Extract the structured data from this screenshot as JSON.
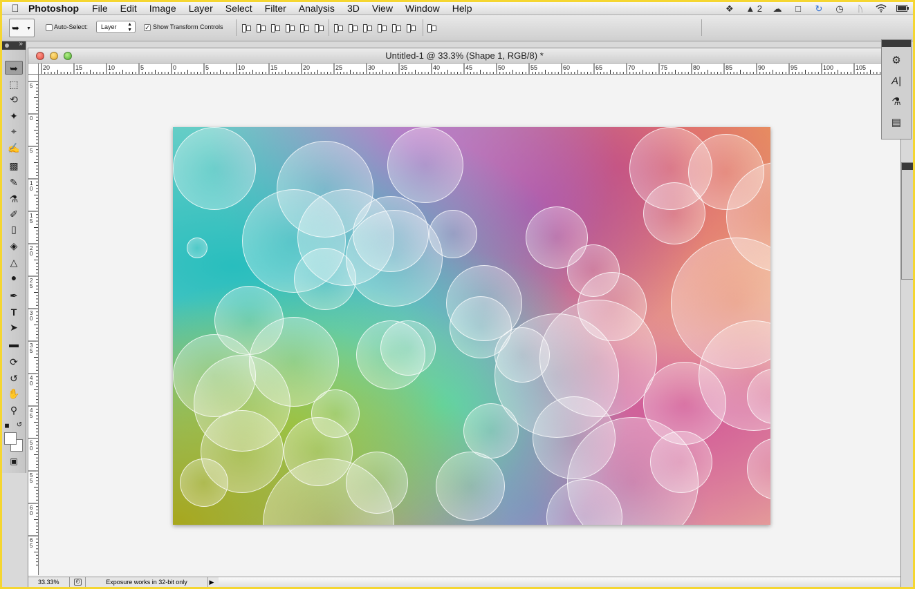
{
  "menubar": {
    "app_name": "Photoshop",
    "items": [
      "File",
      "Edit",
      "Image",
      "Layer",
      "Select",
      "Filter",
      "Analysis",
      "3D",
      "View",
      "Window",
      "Help"
    ],
    "status_icons": [
      "dropbox-icon",
      "adobe-icon",
      "cloud-icon",
      "document-icon",
      "sync-icon",
      "time-machine-icon",
      "bluetooth-icon",
      "wifi-icon",
      "battery-icon"
    ],
    "adobe_count": "2"
  },
  "options_bar": {
    "auto_select_label": "Auto-Select:",
    "auto_select_checked": false,
    "auto_select_value": "Layer",
    "show_transform_label": "Show Transform Controls",
    "show_transform_checked": true
  },
  "document": {
    "title": "Untitled-1 @ 33.3% (Shape 1, RGB/8) *",
    "ruler_h_labels": [
      "20",
      "15",
      "10",
      "5",
      "0",
      "5",
      "10",
      "15",
      "20",
      "25",
      "30",
      "35",
      "40",
      "45",
      "50",
      "55",
      "60",
      "65",
      "70",
      "75",
      "80",
      "85",
      "90",
      "95",
      "100",
      "105"
    ],
    "ruler_v_labels": [
      "5",
      "0",
      "5",
      "10",
      "15",
      "20",
      "25",
      "30",
      "35",
      "40",
      "45",
      "50",
      "55",
      "60",
      "65"
    ]
  },
  "statusbar": {
    "zoom": "33.33%",
    "info": "Exposure works in 32-bit only"
  },
  "colors": {
    "frame_border": "#f5d631",
    "foreground": "#ffffff",
    "background": "#ffffff"
  }
}
